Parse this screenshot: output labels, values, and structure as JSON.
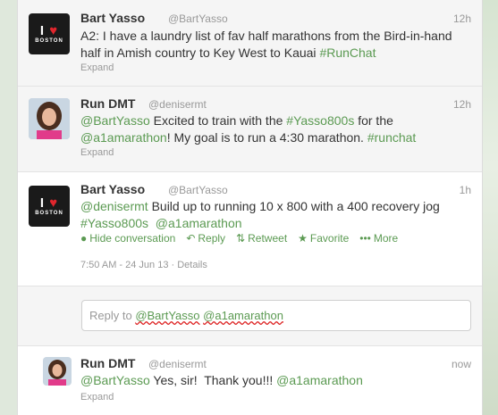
{
  "tweets": [
    {
      "name": "Bart Yasso",
      "handle": "@BartYasso",
      "time": "12h",
      "text_pre": "A2: I have a laundry list of fav half marathons from the Bird-in-hand half in Amish country to Key West to Kauai ",
      "hashtag": "#RunChat",
      "expand": "Expand",
      "avatar_icon": "i-love-boston-logo"
    },
    {
      "name": "Run DMT",
      "handle": "@denisermt",
      "time": "12h",
      "mention1": "@BartYasso",
      "text1": " Excited to train with the ",
      "hashtag1": "#Yasso800s",
      "text2": " for the",
      "mention2": "@a1amarathon",
      "text3": "! My goal is to run a 4:30 marathon. ",
      "hashtag2": "#runchat",
      "expand": "Expand"
    },
    {
      "name": "Bart Yasso",
      "handle": "@BartYasso",
      "time": "1h",
      "mention1": "@denisermt",
      "text1": " Build up to running 10 x 800 with a 400 recovery jog",
      "hashtag1": "#Yasso800s",
      "mention2": "@a1amarathon",
      "actions": {
        "hide": "Hide conversation",
        "reply": "Reply",
        "retweet": "Retweet",
        "favorite": "Favorite",
        "more": "More"
      },
      "timestamp": "7:50 AM - 24 Jun 13",
      "details": "Details"
    },
    {
      "name": "Run DMT",
      "handle": "@denisermt",
      "time": "now",
      "mention1": "@BartYasso",
      "text1": " Yes, sir!  Thank you!!! ",
      "mention2": "@a1amarathon",
      "expand": "Expand"
    }
  ],
  "reply_box": {
    "prefix": "Reply to ",
    "mention1": "@BartYasso",
    "mention2": "@a1amarathon"
  },
  "colors": {
    "link": "#5b9a52",
    "muted": "#999999",
    "text": "#333333"
  }
}
